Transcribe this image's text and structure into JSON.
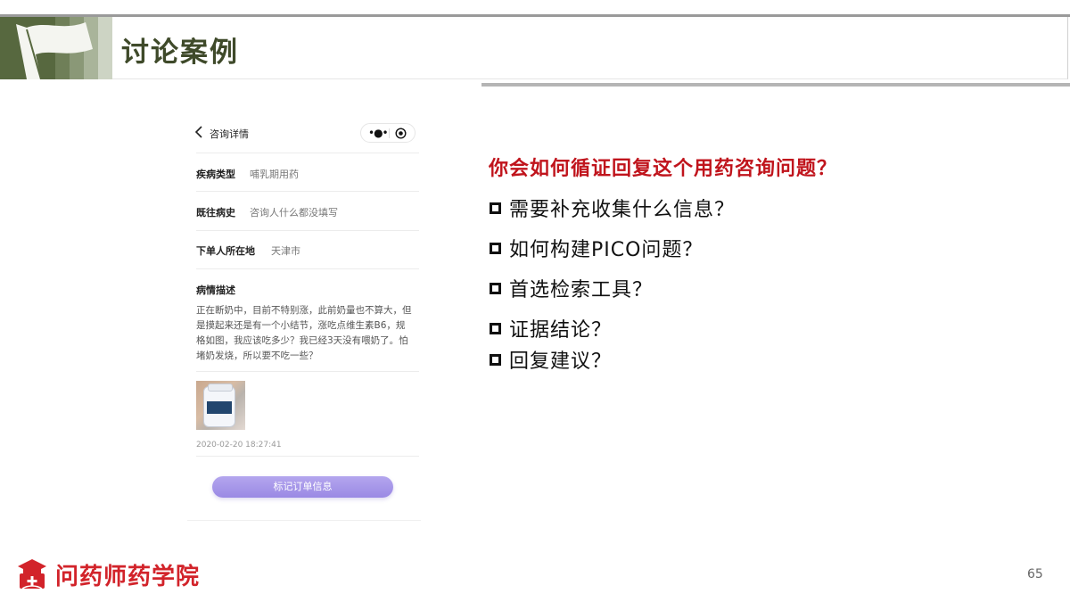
{
  "slide": {
    "title": "讨论案例",
    "page_number": "65"
  },
  "phone": {
    "header_title": "咨询详情",
    "fields": [
      {
        "label": "疾病类型",
        "value": "哺乳期用药"
      },
      {
        "label": "既往病史",
        "value": "咨询人什么都没填写"
      },
      {
        "label": "下单人所在地",
        "value": "天津市"
      }
    ],
    "description_label": "病情描述",
    "description_text": "正在断奶中，目前不特别涨，此前奶量也不算大，但是摸起来还是有一个小结节，涨吃点维生素B6，规格如图，我应该吃多少？我已经3天没有喂奶了。怕堵奶发烧，所以要不吃一些？",
    "timestamp": "2020-02-20 18:27:41",
    "button_label": "标记订单信息"
  },
  "panel": {
    "question": "你会如何循证回复这个用药咨询问题？",
    "bullets": [
      "需要补充收集什么信息？",
      "如何构建PICO问题？",
      "首选检索工具？",
      "证据结论？",
      "回复建议？"
    ]
  },
  "footer": {
    "brand": "问药师药学院"
  },
  "colors": {
    "accent_red": "#c0141c",
    "header_green": "#57683f",
    "button_purple": "#9a89e4"
  }
}
